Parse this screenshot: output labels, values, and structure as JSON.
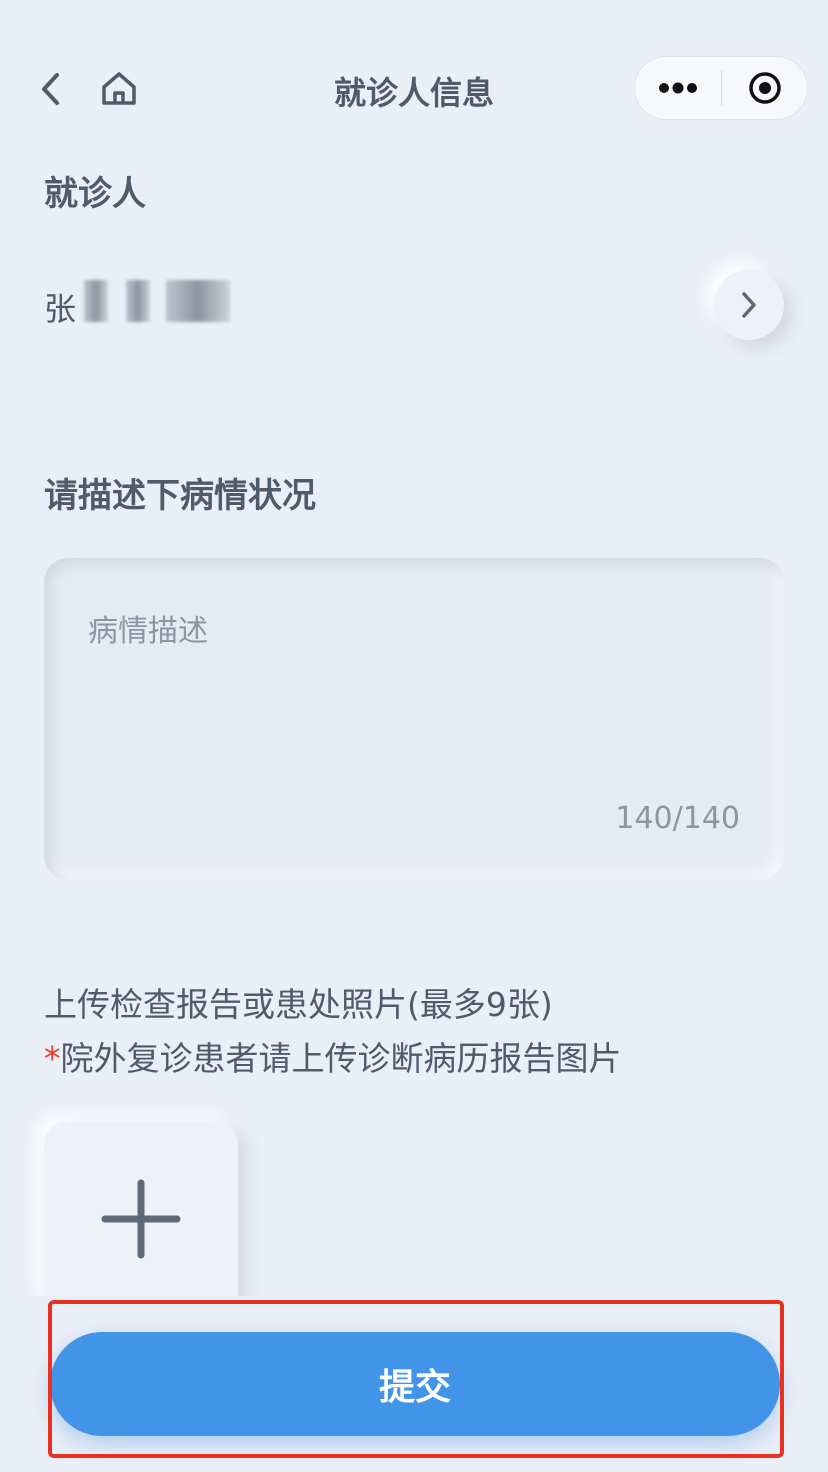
{
  "nav": {
    "title": "就诊人信息",
    "back_icon": "chevron-left-icon",
    "home_icon": "home-icon",
    "capsule": {
      "more_icon": "more-dots-icon",
      "close_icon": "target-circle-icon"
    }
  },
  "patient": {
    "section_title": "就诊人",
    "name_visible_prefix": "张",
    "arrow_icon": "chevron-right-icon"
  },
  "description": {
    "section_title": "请描述下病情状况",
    "placeholder": "病情描述",
    "counter": "140/140"
  },
  "upload": {
    "instruction": "上传检查报告或患处照片(最多9张)",
    "required_mark": "*",
    "note": "院外复诊患者请上传诊断病历报告图片",
    "add_icon": "plus-icon"
  },
  "actions": {
    "submit_label": "提交"
  },
  "colors": {
    "background": "#eaeef6",
    "primary": "#4294e8",
    "text": "#4f5a6a",
    "placeholder": "#8b95a3",
    "required": "#e83b2c",
    "highlight": "#e8321f"
  }
}
